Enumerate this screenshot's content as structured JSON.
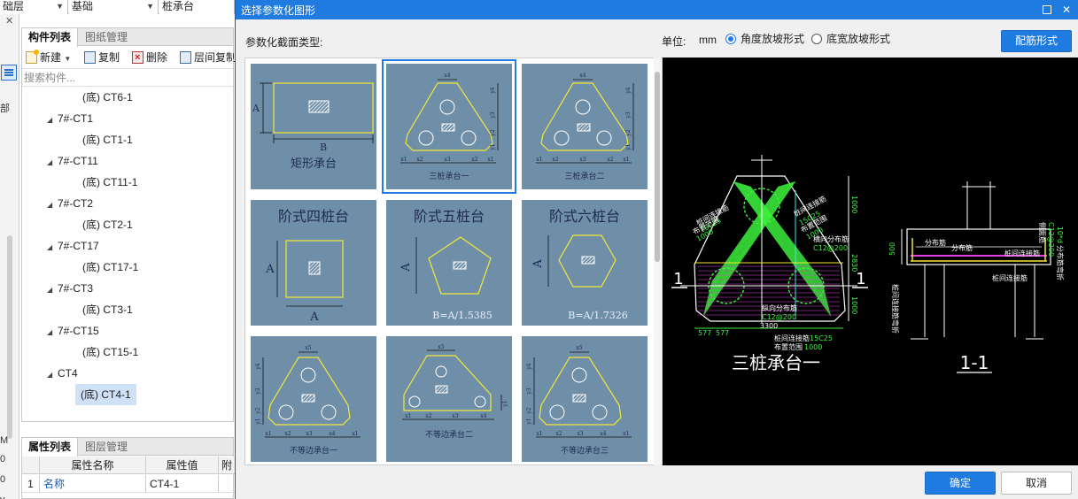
{
  "bg": {
    "combos": [
      {
        "value": "础层"
      },
      {
        "value": "基础"
      },
      {
        "value": "桩承台"
      }
    ],
    "strip_chars": [
      "部",
      "M",
      "0",
      "0",
      "y"
    ],
    "list_panel": {
      "tabs": [
        "构件列表",
        "图纸管理"
      ],
      "toolbar": {
        "new": "新建",
        "copy": "复制",
        "delete": "删除",
        "floor_copy": "层间复制"
      },
      "search_placeholder": "搜索构件...",
      "tree": [
        {
          "label": "(底) CT6-1",
          "level": 2
        },
        {
          "label": "7#-CT1",
          "level": 1
        },
        {
          "label": "(底) CT1-1",
          "level": 2
        },
        {
          "label": "7#-CT11",
          "level": 1
        },
        {
          "label": "(底) CT11-1",
          "level": 2
        },
        {
          "label": "7#-CT2",
          "level": 1
        },
        {
          "label": "(底) CT2-1",
          "level": 2
        },
        {
          "label": "7#-CT17",
          "level": 1
        },
        {
          "label": "(底) CT17-1",
          "level": 2
        },
        {
          "label": "7#-CT3",
          "level": 1
        },
        {
          "label": "(底) CT3-1",
          "level": 2
        },
        {
          "label": "7#-CT15",
          "level": 1
        },
        {
          "label": "(底) CT15-1",
          "level": 2
        },
        {
          "label": "CT4",
          "level": 1
        },
        {
          "label": "(底) CT4-1",
          "level": 2,
          "selected": true
        }
      ]
    },
    "attr_panel": {
      "tabs": [
        "属性列表",
        "图层管理"
      ],
      "columns": [
        "属性名称",
        "属性值",
        "附"
      ],
      "rows": [
        {
          "index": "1",
          "name": "名称",
          "value": "CT4-1"
        }
      ]
    }
  },
  "dialog": {
    "title": "选择参数化图形",
    "section_label": "参数化截面类型:",
    "unit_label": "单位:",
    "unit_value": "mm",
    "radio_options": [
      {
        "label": "角度放坡形式",
        "checked": true
      },
      {
        "label": "底宽放坡形式",
        "checked": false
      }
    ],
    "rebar_button": "配筋形式",
    "ok_button": "确定",
    "cancel_button": "取消",
    "shapes": [
      {
        "label": "矩形承台",
        "dims": [
          "A",
          "B"
        ]
      },
      {
        "label": "三桩承台一",
        "dims": [
          "x4",
          "y4",
          "y3",
          "y2",
          "y1",
          "x1",
          "x2",
          "x3",
          "x2",
          "x1"
        ],
        "selected": true
      },
      {
        "label": "三桩承台二",
        "dims": [
          "x4",
          "y4",
          "y3",
          "y2",
          "y1",
          "x1",
          "x2",
          "x3",
          "x2",
          "x1"
        ]
      },
      {
        "label": "阶式四桩台",
        "dims": [
          "A",
          "A"
        ]
      },
      {
        "label": "阶式五桩台",
        "dims": [
          "A",
          "B=A/1.5385"
        ]
      },
      {
        "label": "阶式六桩台",
        "dims": [
          "A",
          "B=A/1.7326"
        ]
      },
      {
        "label": "不等边承台一",
        "dims": [
          "x5",
          "y4",
          "y3",
          "y2",
          "y1",
          "x1",
          "x2",
          "x3",
          "x4",
          "x1"
        ]
      },
      {
        "label": "不等边承台二",
        "dims": [
          "x5",
          "y1",
          "x1",
          "x2",
          "x3",
          "x4"
        ]
      },
      {
        "label": "不等边承台三",
        "dims": [
          "x5",
          "y4",
          "y3",
          "y2",
          "y1",
          "x1",
          "x2",
          "x3",
          "x4",
          "x1"
        ]
      }
    ],
    "preview": {
      "title": "三桩承台一",
      "section_title": "1-1",
      "section_mark": "1",
      "plan_labels": {
        "tie_rebar_left": "桩间连接筋",
        "tie_rebar_left_spec": "15C25",
        "range_left": "布置范围",
        "range_left_val": "1000",
        "tie_rebar_right": "桩间连接筋",
        "tie_rebar_right_spec": "15C25",
        "range_right": "布置范围",
        "range_right_val": "1000",
        "dist_rebar_h": "横向分布筋",
        "dist_rebar_h_spec": "C12@200",
        "dist_rebar_v": "纵向分布筋",
        "dist_rebar_v_spec": "C12@200",
        "tie_rebar_bottom": "桩间连接筋",
        "tie_rebar_bottom_spec": "15C25",
        "range_bottom": "布置范围",
        "range_bottom_val": "1000",
        "dim_total": "3300",
        "dim_left": "577",
        "dim_left2": "577",
        "dim_v1": "1000",
        "dim_v2": "1000",
        "dim_v3": "1000",
        "dim_v_total": "2830"
      },
      "section_labels": {
        "dist1": "分布筋",
        "dist2": "分布筋",
        "tie": "桩间连接筋",
        "tie_bottom": "桩间连接筋",
        "side": "侧面筋",
        "side_spec": "C12@200",
        "height": "500",
        "left_text": "桩间连接筋弯折",
        "right_text": "分布筋弯折",
        "right_val": "10*d"
      }
    }
  }
}
